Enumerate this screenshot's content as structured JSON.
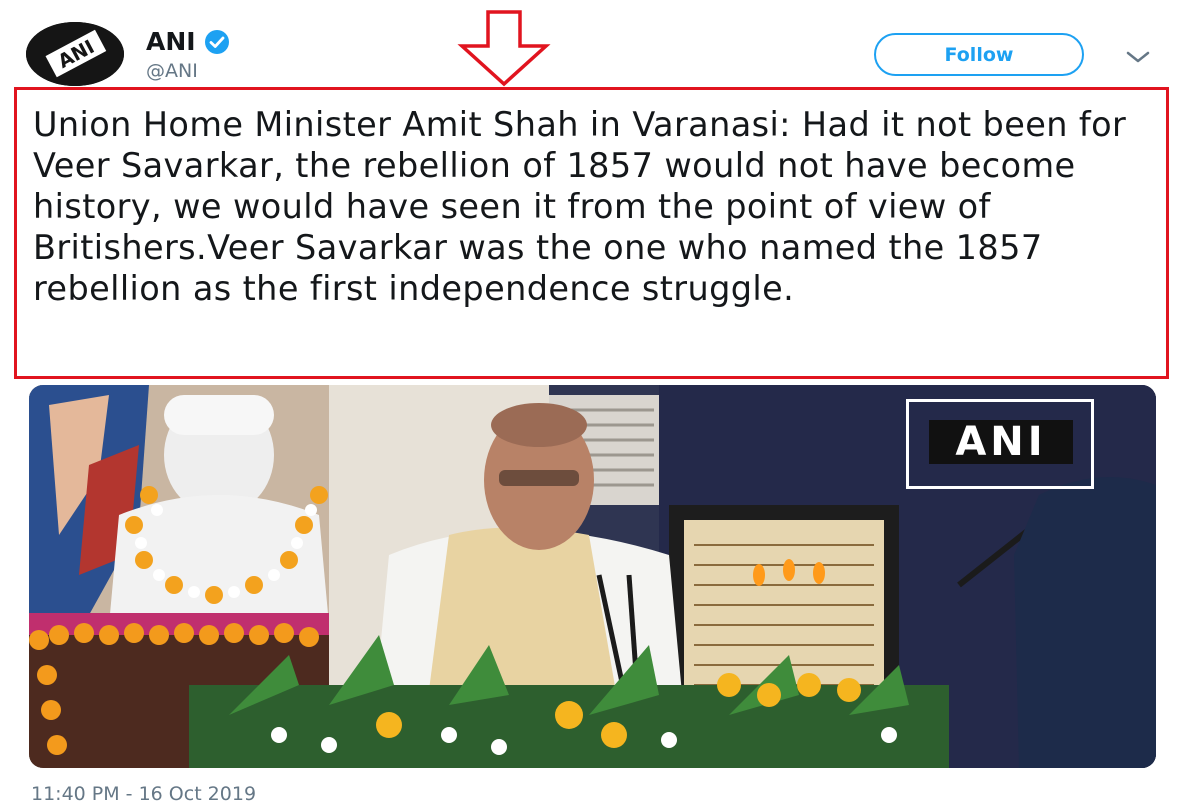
{
  "tweet": {
    "author_name": "ANI",
    "author_handle": "@ANI",
    "verified": true,
    "follow_label": "Follow",
    "text": "Union Home Minister Amit Shah in Varanasi: Had it not been for Veer Savarkar, the rebellion of 1857 would not have become history, we would have seen it from the point of view of Britishers.Veer Savarkar was the one who named the 1857 rebellion as the first independence struggle.",
    "timestamp": "11:40 PM - 16 Oct 2019",
    "media": {
      "watermark_text": "ANI",
      "logo_text": "ANI"
    }
  },
  "colors": {
    "accent": "#1da1f2",
    "highlight_border": "#e1141f",
    "text": "#14171a",
    "secondary_text": "#657786"
  },
  "icons": {
    "verified": "verified-badge-icon",
    "chevron": "chevron-down-icon",
    "annotation": "down-arrow-icon"
  }
}
